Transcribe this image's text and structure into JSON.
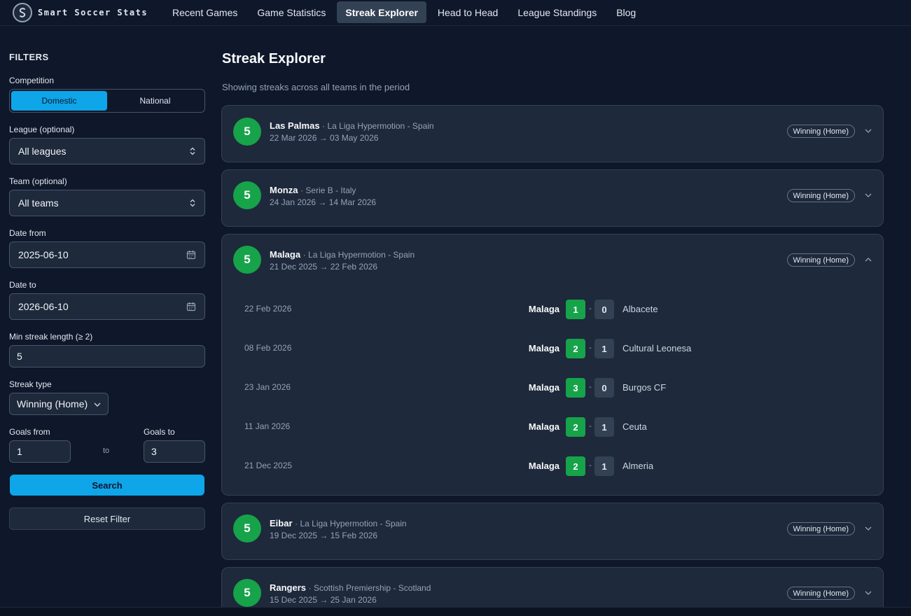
{
  "brand": {
    "name": "Smart Soccer Stats"
  },
  "nav": {
    "items": [
      {
        "label": "Recent Games",
        "active": false
      },
      {
        "label": "Game Statistics",
        "active": false
      },
      {
        "label": "Streak Explorer",
        "active": true
      },
      {
        "label": "Head to Head",
        "active": false
      },
      {
        "label": "League Standings",
        "active": false
      },
      {
        "label": "Blog",
        "active": false
      }
    ]
  },
  "filters": {
    "title": "FILTERS",
    "competition_label": "Competition",
    "competition_options": [
      "Domestic",
      "National"
    ],
    "competition_selected": "Domestic",
    "league_label": "League (optional)",
    "league_value": "All leagues",
    "team_label": "Team (optional)",
    "team_value": "All teams",
    "date_from_label": "Date from",
    "date_from_value": "2025-06-10",
    "date_to_label": "Date to",
    "date_to_value": "2026-06-10",
    "min_streak_label": "Min streak length (≥ 2)",
    "min_streak_value": "5",
    "streak_type_label": "Streak type",
    "streak_type_value": "Winning (Home)",
    "goals_from_label": "Goals from",
    "goals_from_value": "1",
    "goals_to_label": "Goals to",
    "goals_to_value": "3",
    "to_text": "to",
    "search_label": "Search",
    "reset_label": "Reset Filter"
  },
  "main": {
    "title": "Streak Explorer",
    "subtitle": "Showing streaks across all teams in the period",
    "streaks": [
      {
        "length": "5",
        "team": "Las Palmas",
        "league": "· La Liga Hypermotion - Spain",
        "range": "22 Mar 2026 → 03 May 2026",
        "type": "Winning (Home)",
        "expanded": false
      },
      {
        "length": "5",
        "team": "Monza",
        "league": "· Serie B - Italy",
        "range": "24 Jan 2026 → 14 Mar 2026",
        "type": "Winning (Home)",
        "expanded": false
      },
      {
        "length": "5",
        "team": "Malaga",
        "league": "· La Liga Hypermotion - Spain",
        "range": "21 Dec 2025 → 22 Feb 2026",
        "type": "Winning (Home)",
        "expanded": true,
        "matches": [
          {
            "date": "22 Feb 2026",
            "home": "Malaga",
            "home_score": "1",
            "sep": "-",
            "away_score": "0",
            "away": "Albacete"
          },
          {
            "date": "08 Feb 2026",
            "home": "Malaga",
            "home_score": "2",
            "sep": "-",
            "away_score": "1",
            "away": "Cultural Leonesa"
          },
          {
            "date": "23 Jan 2026",
            "home": "Malaga",
            "home_score": "3",
            "sep": "-",
            "away_score": "0",
            "away": "Burgos CF"
          },
          {
            "date": "11 Jan 2026",
            "home": "Malaga",
            "home_score": "2",
            "sep": "-",
            "away_score": "1",
            "away": "Ceuta"
          },
          {
            "date": "21 Dec 2025",
            "home": "Malaga",
            "home_score": "2",
            "sep": "-",
            "away_score": "1",
            "away": "Almeria"
          }
        ]
      },
      {
        "length": "5",
        "team": "Eibar",
        "league": "· La Liga Hypermotion - Spain",
        "range": "19 Dec 2025 → 15 Feb 2026",
        "type": "Winning (Home)",
        "expanded": false
      },
      {
        "length": "5",
        "team": "Rangers",
        "league": "· Scottish Premiership - Scotland",
        "range": "15 Dec 2025 → 25 Jan 2026",
        "type": "Winning (Home)",
        "expanded": false
      }
    ]
  },
  "colors": {
    "background": "#0f172a",
    "card": "#1e293b",
    "accent": "#0ea5e9",
    "win_green": "#16a34a"
  },
  "icons": [
    "logo-icon",
    "updown-icon",
    "calendar-icon",
    "chevron-down-icon",
    "chevron-up-icon"
  ]
}
